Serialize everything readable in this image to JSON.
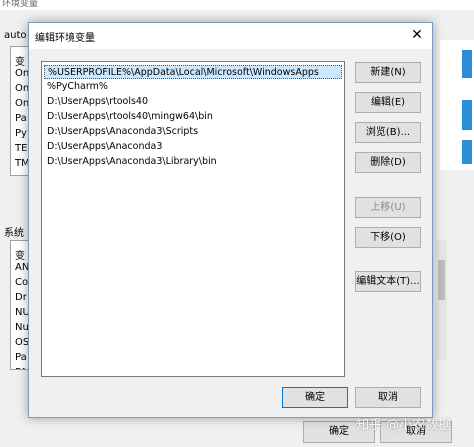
{
  "background": {
    "window_title": "环境变量",
    "user_section_label": "auto",
    "user_list_items": [
      "变",
      "On",
      "On",
      "On",
      "Pa",
      "Py",
      "TE",
      "TM"
    ],
    "system_section_label": "系统",
    "system_list_items": [
      "变",
      "AN",
      "Co",
      "Dr",
      "NU",
      "Nu",
      "OS",
      "Pa",
      "PA"
    ],
    "ok_label": "确定",
    "cancel_label": "取消"
  },
  "dialog": {
    "title": "编辑环境变量",
    "close_glyph": "✕",
    "paths": [
      "%USERPROFILE%\\AppData\\Local\\Microsoft\\WindowsApps",
      "%PyCharm%",
      "D:\\UserApps\\rtools40",
      "D:\\UserApps\\rtools40\\mingw64\\bin",
      "D:\\UserApps\\Anaconda3\\Scripts",
      "D:\\UserApps\\Anaconda3",
      "D:\\UserApps\\Anaconda3\\Library\\bin"
    ],
    "selected_index": 0,
    "buttons": {
      "new": "新建(N)",
      "edit": "编辑(E)",
      "browse": "浏览(B)...",
      "delete": "删除(D)",
      "move_up": "上移(U)",
      "move_down": "下移(O)",
      "edit_text": "编辑文本(T)..."
    },
    "ok_label": "确定",
    "cancel_label": "取消"
  },
  "watermark": "知乎 @小农数据",
  "colors": {
    "selection": "#cce8ff",
    "accent_border": "#0078d7"
  }
}
